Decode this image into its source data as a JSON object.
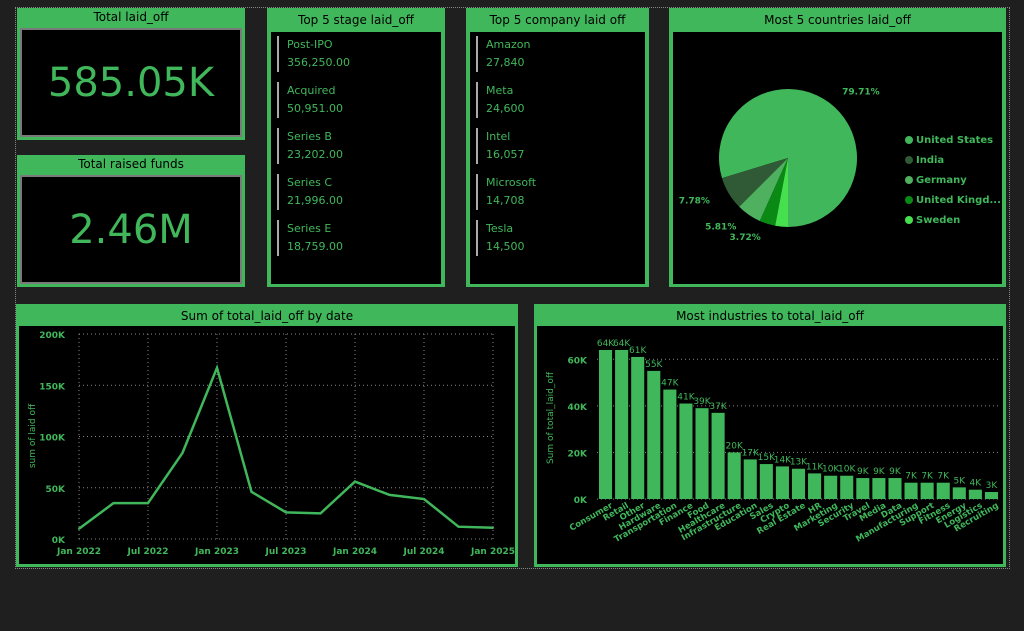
{
  "kpis": {
    "laid_off": {
      "title": "Total laid_off",
      "value": "585.05K"
    },
    "raised": {
      "title": "Total raised funds",
      "value": "2.46M"
    }
  },
  "stage": {
    "title": "Top 5 stage laid_off",
    "items": [
      {
        "label": "Post-IPO",
        "value": "356,250.00"
      },
      {
        "label": "Acquired",
        "value": "50,951.00"
      },
      {
        "label": "Series B",
        "value": "23,202.00"
      },
      {
        "label": "Series C",
        "value": "21,996.00"
      },
      {
        "label": "Series E",
        "value": "18,759.00"
      }
    ]
  },
  "company": {
    "title": "Top 5 company laid off",
    "items": [
      {
        "label": "Amazon",
        "value": "27,840"
      },
      {
        "label": "Meta",
        "value": "24,600"
      },
      {
        "label": "Intel",
        "value": "16,057"
      },
      {
        "label": "Microsoft",
        "value": "14,708"
      },
      {
        "label": "Tesla",
        "value": "14,500"
      }
    ]
  },
  "chart_data": [
    {
      "type": "pie",
      "title": "Most 5 countries laid_off",
      "legend_position": "right",
      "slices": [
        {
          "name": "United States",
          "value": 79.71,
          "label": "79.71%",
          "color": "#41b75b"
        },
        {
          "name": "India",
          "value": 7.78,
          "label": "7.78%",
          "color": "#2f5a35"
        },
        {
          "name": "Germany",
          "value": 5.81,
          "label": "5.81%",
          "color": "#4fb060"
        },
        {
          "name": "United Kingd...",
          "value": 3.72,
          "label": "3.72%",
          "color": "#0a8a14"
        },
        {
          "name": "Sweden",
          "value": 2.98,
          "label": "",
          "color": "#46e04e"
        }
      ]
    },
    {
      "type": "line",
      "title": "Sum of total_laid_off by date",
      "xlabel": "",
      "ylabel": "sum of laid off",
      "ylim": [
        0,
        200000
      ],
      "grid": true,
      "yticks": [
        "0K",
        "50K",
        "100K",
        "150K",
        "200K"
      ],
      "xticks": [
        "Jan 2022",
        "Jul 2022",
        "Jan 2023",
        "Jul 2023",
        "Jan 2024",
        "Jul 2024",
        "Jan 2025"
      ],
      "x": [
        "2022-01",
        "2022-04",
        "2022-07",
        "2022-10",
        "2023-01",
        "2023-04",
        "2023-07",
        "2023-10",
        "2024-01",
        "2024-04",
        "2024-07",
        "2024-10",
        "2025-01"
      ],
      "values": [
        10000,
        35000,
        35000,
        84000,
        167000,
        46000,
        26000,
        25000,
        56000,
        43000,
        39000,
        12000,
        11000
      ]
    },
    {
      "type": "bar",
      "title": "Most industries to total_laid_off",
      "ylabel": "Sum of total_laid_off",
      "ylim": [
        0,
        70000
      ],
      "grid": true,
      "yticks": [
        "0K",
        "20K",
        "40K",
        "60K"
      ],
      "categories": [
        "Consumer",
        "Retail",
        "Other",
        "Hardware",
        "Transportation",
        "Finance",
        "Food",
        "Healthcare",
        "Infrastructure",
        "Education",
        "Sales",
        "Crypto",
        "Real Estate",
        "HR",
        "Marketing",
        "Security",
        "Travel",
        "Media",
        "Data",
        "Manufacturing",
        "Support",
        "Fitness",
        "Energy",
        "Logistics",
        "Recruiting"
      ],
      "values": [
        64000,
        64000,
        61000,
        55000,
        47000,
        41000,
        39000,
        37000,
        20000,
        17000,
        15000,
        14000,
        13000,
        11000,
        10000,
        10000,
        9000,
        9000,
        9000,
        7000,
        7000,
        7000,
        5000,
        4000,
        3000
      ],
      "labels": [
        "64K",
        "64K",
        "61K",
        "55K",
        "47K",
        "41K",
        "39K",
        "37K",
        "20K",
        "17K",
        "15K",
        "14K",
        "13K",
        "11K",
        "10K",
        "10K",
        "9K",
        "9K",
        "9K",
        "7K",
        "7K",
        "7K",
        "5K",
        "4K",
        "3K"
      ]
    }
  ]
}
